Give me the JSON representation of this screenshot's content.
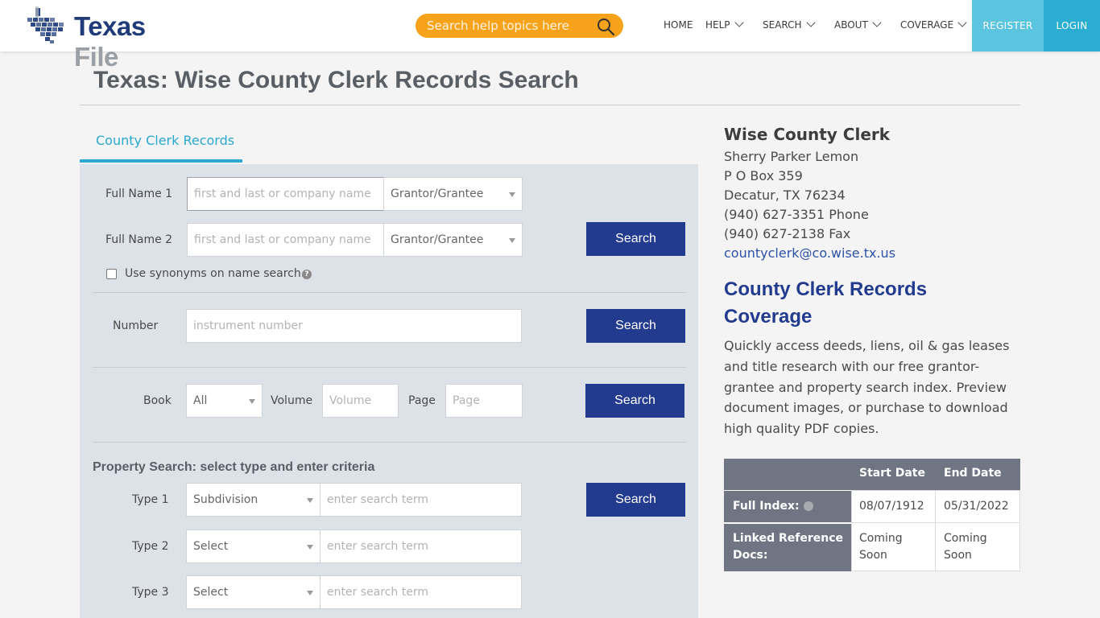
{
  "header": {
    "logo": {
      "part1": "Texas",
      "part2": "File"
    },
    "search": {
      "placeholder": "Search help topics here"
    },
    "nav": [
      {
        "label": "HOME",
        "has_dropdown": false
      },
      {
        "label": "HELP",
        "has_dropdown": true
      },
      {
        "label": "SEARCH",
        "has_dropdown": true
      },
      {
        "label": "ABOUT",
        "has_dropdown": true
      },
      {
        "label": "COVERAGE",
        "has_dropdown": true
      }
    ],
    "register_label": "REGISTER",
    "login_label": "LOGIN"
  },
  "page_title": "Texas: Wise County Clerk Records Search",
  "tabs": [
    {
      "label": "County Clerk Records",
      "active": true
    }
  ],
  "form": {
    "full_name_1": {
      "label": "Full Name 1",
      "placeholder": "first and last or company name",
      "role": "Grantor/Grantee"
    },
    "full_name_2": {
      "label": "Full Name 2",
      "placeholder": "first and last or company name",
      "role": "Grantor/Grantee"
    },
    "synonyms_label": "Use synonyms on name search.",
    "number": {
      "label": "Number",
      "placeholder": "instrument number"
    },
    "book": {
      "label": "Book",
      "value": "All"
    },
    "volume": {
      "label": "Volume",
      "placeholder": "Volume"
    },
    "page": {
      "label": "Page",
      "placeholder": "Page"
    },
    "property_heading": "Property Search: select type and enter criteria",
    "types": [
      {
        "label": "Type 1",
        "value": "Subdivision",
        "placeholder": "enter search term"
      },
      {
        "label": "Type 2",
        "value": "Select",
        "placeholder": "enter search term"
      },
      {
        "label": "Type 3",
        "value": "Select",
        "placeholder": "enter search term"
      }
    ],
    "search_label": "Search"
  },
  "clerk": {
    "title": "Wise County Clerk",
    "name": "Sherry Parker Lemon",
    "address1": "P O Box 359",
    "address2": "Decatur, TX 76234",
    "phone": "(940) 627-3351 Phone",
    "fax": "(940) 627-2138 Fax",
    "email": "countyclerk@co.wise.tx.us"
  },
  "coverage": {
    "heading": "County Clerk Records Coverage",
    "description": "Quickly access deeds, liens, oil & gas leases and title research with our free grantor-grantee and property search index. Preview document images, or purchase to download high quality PDF copies.",
    "columns": [
      "",
      "Start Date",
      "End Date"
    ],
    "rows": [
      {
        "label": "Full Index:",
        "start": "08/07/1912",
        "end": "05/31/2022",
        "has_info": true
      },
      {
        "label": "Linked Reference Docs:",
        "start": "Coming Soon",
        "end": "Coming Soon",
        "has_info": false
      }
    ]
  },
  "colors": {
    "accent_orange": "#f7a21b",
    "tab_blue": "#2aa8cf",
    "button_navy": "#223b8f",
    "register_blue": "#5bc4df",
    "login_blue": "#29aed1",
    "table_header_gray": "#6f7582"
  }
}
